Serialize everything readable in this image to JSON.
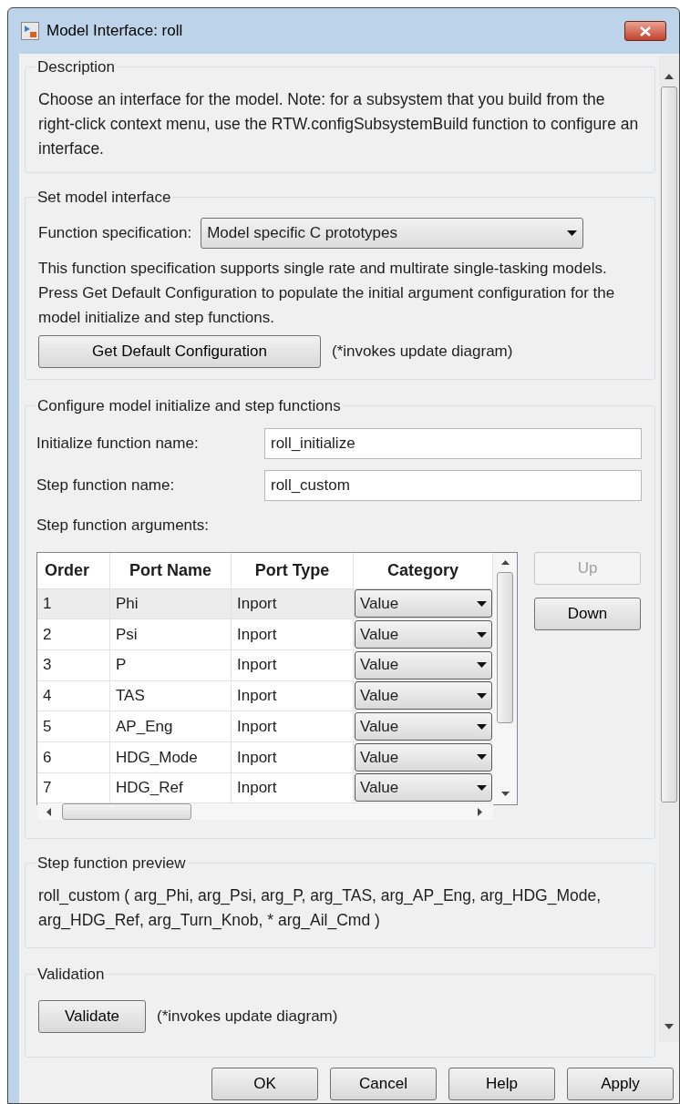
{
  "window": {
    "title": "Model Interface: roll"
  },
  "description": {
    "title": "Description",
    "text": "Choose an interface for the model. Note: for a subsystem that you build from the right-click context menu, use the RTW.configSubsystemBuild function to configure an interface."
  },
  "set_model_interface": {
    "title": "Set model interface",
    "function_specification": {
      "label": "Function specification:",
      "value": "Model specific C prototypes"
    },
    "text": "This function specification supports single rate and multirate single-tasking models.  Press Get Default Configuration to populate the initial argument configuration for the model initialize and step functions.",
    "button": "Get Default Configuration",
    "note": "(*invokes update diagram)"
  },
  "configure": {
    "title": "Configure model initialize and step functions",
    "fields": [
      {
        "label": "Initialize function name:",
        "value": "roll_initialize"
      },
      {
        "label": "Step function name:",
        "value": "roll_custom"
      }
    ],
    "arguments_label": "Step function arguments:",
    "table": {
      "columns": [
        "Order",
        "Port Name",
        "Port Type",
        "Category"
      ],
      "rows": [
        {
          "order": "1",
          "port_name": "Phi",
          "port_type": "Inport",
          "category": "Value",
          "selected": true
        },
        {
          "order": "2",
          "port_name": "Psi",
          "port_type": "Inport",
          "category": "Value",
          "selected": false
        },
        {
          "order": "3",
          "port_name": "P",
          "port_type": "Inport",
          "category": "Value",
          "selected": false
        },
        {
          "order": "4",
          "port_name": "TAS",
          "port_type": "Inport",
          "category": "Value",
          "selected": false
        },
        {
          "order": "5",
          "port_name": "AP_Eng",
          "port_type": "Inport",
          "category": "Value",
          "selected": false
        },
        {
          "order": "6",
          "port_name": "HDG_Mode",
          "port_type": "Inport",
          "category": "Value",
          "selected": false
        },
        {
          "order": "7",
          "port_name": "HDG_Ref",
          "port_type": "Inport",
          "category": "Value",
          "selected": false
        }
      ]
    },
    "side_buttons": [
      {
        "label": "Up",
        "disabled": true
      },
      {
        "label": "Down",
        "disabled": false
      }
    ]
  },
  "preview": {
    "title": "Step function preview",
    "text": "roll_custom ( arg_Phi, arg_Psi, arg_P, arg_TAS, arg_AP_Eng, arg_HDG_Mode, arg_HDG_Ref, arg_Turn_Knob, * arg_Ail_Cmd )"
  },
  "validation": {
    "title": "Validation",
    "button": "Validate",
    "note": "(*invokes update diagram)"
  },
  "buttons": [
    "OK",
    "Cancel",
    "Help",
    "Apply"
  ]
}
